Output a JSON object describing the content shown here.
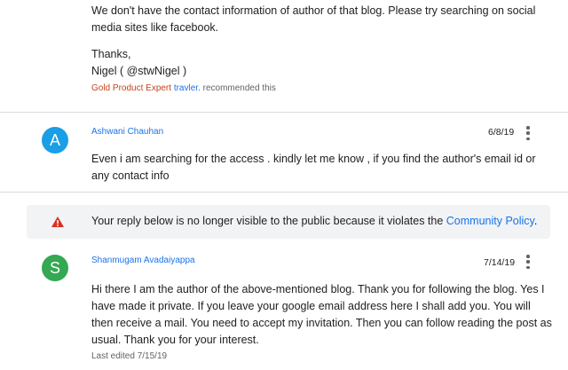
{
  "reply1": {
    "lines": [
      "We don't have the contact information of author of that blog. Please try searching on social media sites like facebook.",
      "Thanks,",
      "Nigel  ( @stwNigel )"
    ],
    "badge": "Gold Product Expert",
    "recommender": "travler",
    "recommended_text": ". recommended this"
  },
  "comment1": {
    "avatar_letter": "A",
    "avatar_color": "#1a9ee6",
    "author": "Ashwani Chauhan",
    "date": "6/8/19",
    "body": "Even i am searching for the access . kindly let me know , if you find the author's email id or any contact info"
  },
  "notice": {
    "text": "Your reply below is no longer visible to the public because it violates the ",
    "link": "Community Policy",
    "end": ".",
    "icon_color": "#d93025"
  },
  "comment2": {
    "avatar_letter": "S",
    "avatar_color": "#34a853",
    "author": "Shanmugam Avadaiyappa",
    "date": "7/14/19",
    "body": "Hi there I am the author of the above-mentioned blog. Thank you for following the blog. Yes I have made it private. If you leave your google email address here I shall add you. You will then receive a mail. You need to accept my invitation. Then you can follow reading the post as usual. Thank you for your interest.",
    "last_edited": "Last edited 7/15/19"
  }
}
